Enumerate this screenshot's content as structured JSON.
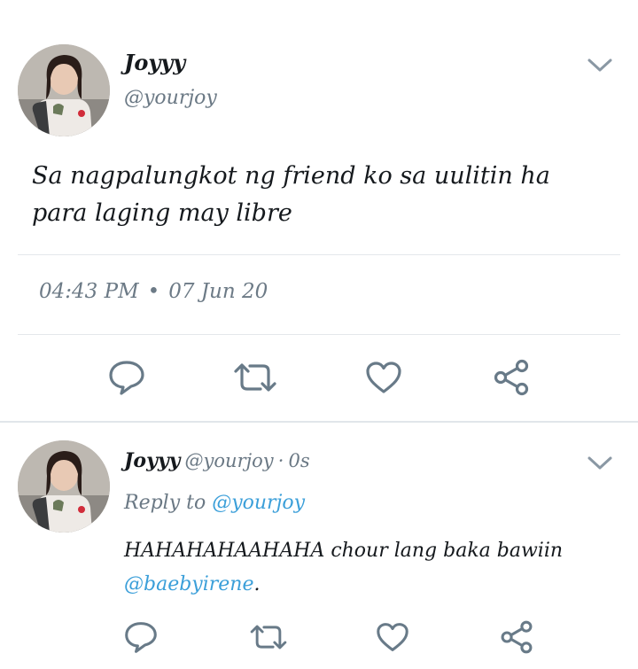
{
  "main_tweet": {
    "name": "Joyyy",
    "handle": "@yourjoy",
    "text": "Sa nagpalungkot ng friend ko sa uulitin ha para laging may libre",
    "time": "04:43 PM",
    "separator": "•",
    "date": "07 Jun 20",
    "menu_icon": "chevron-down-icon",
    "actions": {
      "reply_icon": "reply-icon",
      "retweet_icon": "retweet-icon",
      "like_icon": "heart-icon",
      "share_icon": "share-icon"
    }
  },
  "reply_tweet": {
    "name": "Joyyy",
    "handle": "@yourjoy",
    "separator": "·",
    "time_ago": "0s",
    "reply_to_label": "Reply to",
    "reply_to_handle": "@yourjoy",
    "text": "HAHAHAHAAHAHA chour lang baka bawiin",
    "mention": "@baebyirene",
    "mention_suffix": ".",
    "menu_icon": "chevron-down-icon",
    "actions": {
      "reply_icon": "reply-icon",
      "retweet_icon": "retweet-icon",
      "like_icon": "heart-icon",
      "share_icon": "share-icon"
    }
  },
  "colors": {
    "text": "#15191d",
    "secondary_text": "#6a7884",
    "link": "#3b9fd9",
    "icon": "#687a88",
    "divider": "#e4e8eb"
  }
}
